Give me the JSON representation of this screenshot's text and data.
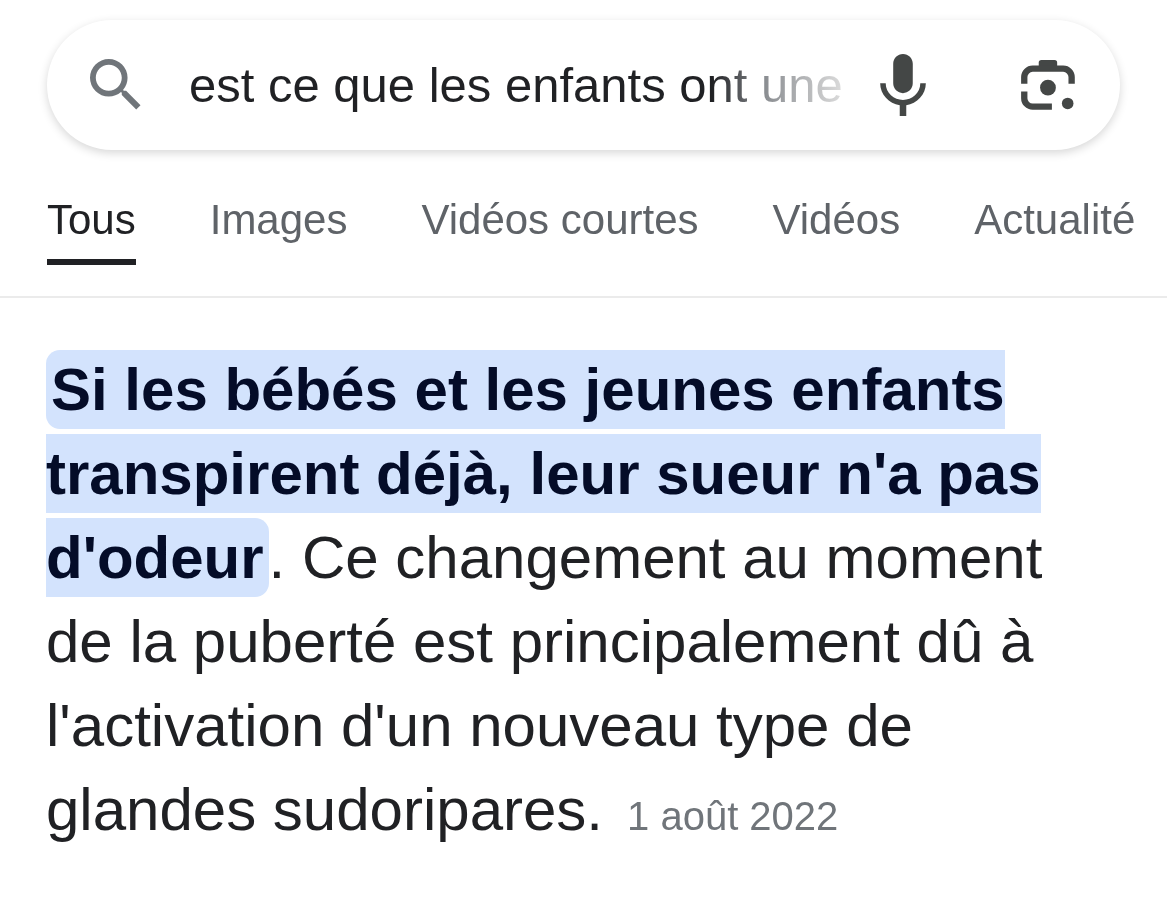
{
  "search_bar": {
    "value": "est ce que les enfants ont une"
  },
  "tabs": [
    {
      "label": "Tous",
      "selected": true
    },
    {
      "label": "Images",
      "selected": false
    },
    {
      "label": "Vidéos courtes",
      "selected": false
    },
    {
      "label": "Vidéos",
      "selected": false
    },
    {
      "label": "Actualité",
      "selected": false
    }
  ],
  "snippet": {
    "text": "**Si les bébés et les jeunes enfants transpirent déjà, leur sueur n'a pas d'odeur**. Ce changement au moment de la puberté est principalement dû à l'activation d'un nouveau type de glandes sudoripares.",
    "date": "1 août 2022"
  }
}
